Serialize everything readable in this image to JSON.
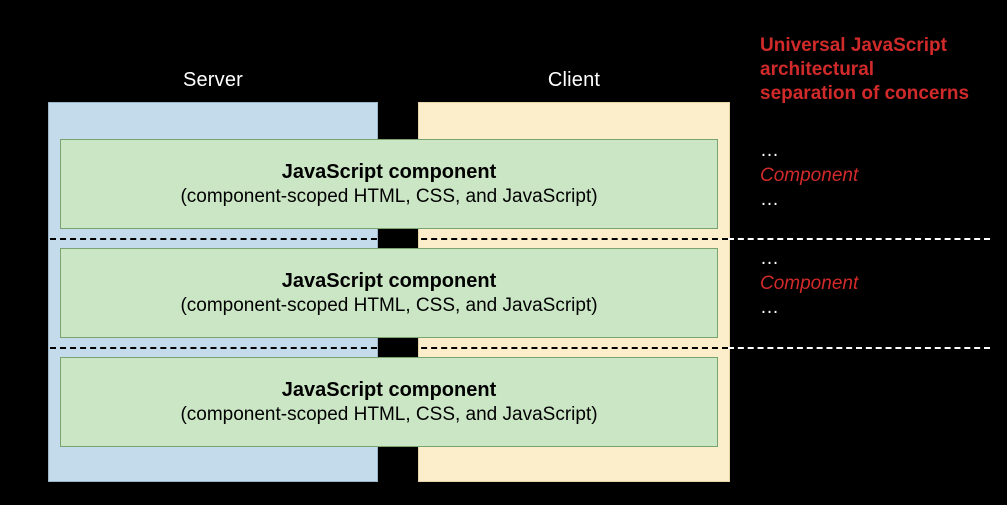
{
  "colors": {
    "accent_red": "#d12a2a",
    "server_bg": "#c3dbeb",
    "client_bg": "#fdeecb",
    "component_bg": "#cbe6c5"
  },
  "columns": {
    "left_label": "Server",
    "right_label": "Client"
  },
  "components": [
    {
      "title": "JavaScript component",
      "subtitle": "(component-scoped HTML, CSS, and JavaScript)"
    },
    {
      "title": "JavaScript component",
      "subtitle": "(component-scoped HTML, CSS, and JavaScript)"
    },
    {
      "title": "JavaScript component",
      "subtitle": "(component-scoped HTML, CSS, and JavaScript)"
    }
  ],
  "annotations": {
    "title_l1": "Universal JavaScript",
    "title_l2": "architectural",
    "title_l3": "separation of concerns",
    "row1_pre": "…",
    "row1_em": "Component",
    "row2_pre": "…",
    "row2_em": "Component"
  }
}
